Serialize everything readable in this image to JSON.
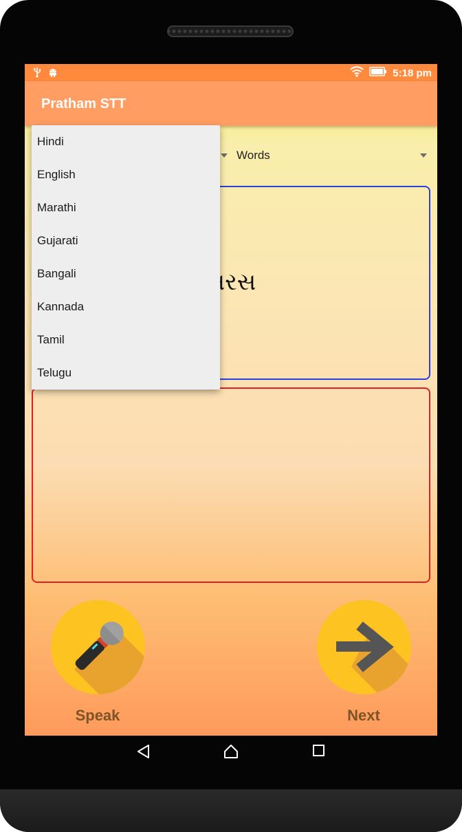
{
  "status_bar": {
    "time": "5:18 pm",
    "icons": [
      "usb-icon",
      "android-debug-icon",
      "wifi-icon",
      "battery-icon"
    ]
  },
  "app_bar": {
    "title": "Pratham STT"
  },
  "type_spinner": {
    "selected": "Words"
  },
  "word_display": {
    "text": "સરસ"
  },
  "language_dropdown": {
    "options": [
      "Hindi",
      "English",
      "Marathi",
      "Gujarati",
      "Bangali",
      "Kannada",
      "Tamil",
      "Telugu"
    ]
  },
  "buttons": {
    "speak_label": "Speak",
    "next_label": "Next"
  },
  "nav_bar": {
    "icons": [
      "back-icon",
      "home-icon",
      "recents-icon"
    ]
  },
  "colors": {
    "status_bar": "#ff8a3d",
    "app_bar": "#ff9d63",
    "button_circle": "#fdc320",
    "word_box_border": "#2c3ee0",
    "result_box_border": "#e02020",
    "button_label": "#7d5328"
  }
}
